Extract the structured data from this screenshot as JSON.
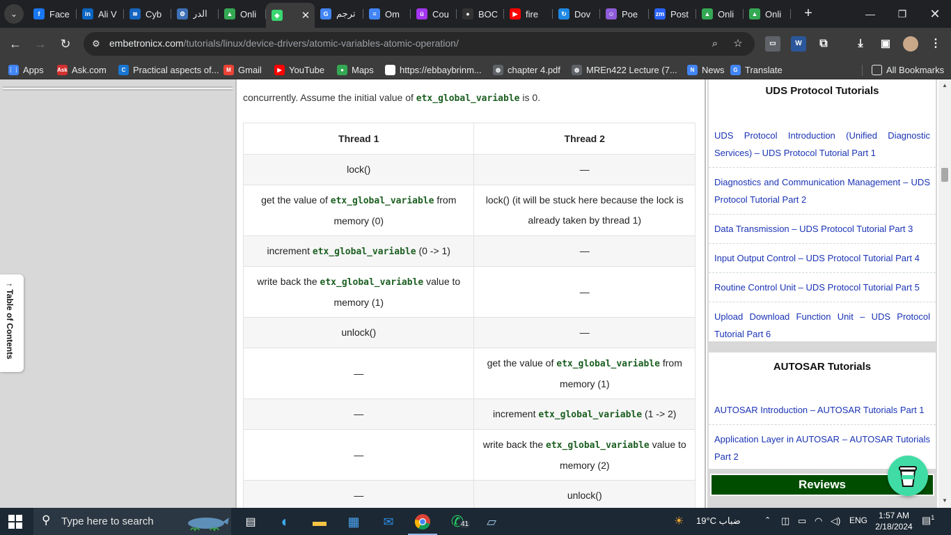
{
  "tabs": [
    {
      "title": "Face",
      "icon": "facebook-icon",
      "color": "#1877f2",
      "glyph": "f"
    },
    {
      "title": "Ali V",
      "icon": "linkedin-icon",
      "color": "#0a66c2",
      "glyph": "in"
    },
    {
      "title": "Cyb",
      "icon": "cyber-icon",
      "color": "#1565c0",
      "glyph": "≋"
    },
    {
      "title": "الدر",
      "icon": "gear-icon",
      "color": "#3d6fb6",
      "glyph": "⚙"
    },
    {
      "title": "Onli",
      "icon": "google-drive-icon",
      "color": "#34a853",
      "glyph": "▲"
    },
    {
      "title": "",
      "icon": "diamond-icon",
      "color": "#3bd671",
      "glyph": "◆",
      "active": true
    },
    {
      "title": "ترجم",
      "icon": "google-translate-icon",
      "color": "#4285f4",
      "glyph": "G"
    },
    {
      "title": "Om",
      "icon": "google-docs-icon",
      "color": "#4285f4",
      "glyph": "≡"
    },
    {
      "title": "Cou",
      "icon": "udemy-icon",
      "color": "#a435f0",
      "glyph": "ü"
    },
    {
      "title": "BOC",
      "icon": "github-icon",
      "color": "#333333",
      "glyph": "●"
    },
    {
      "title": "fire",
      "icon": "youtube-icon",
      "color": "#ff0000",
      "glyph": "▶"
    },
    {
      "title": "Dov",
      "icon": "download-site-icon",
      "color": "#1e88e5",
      "glyph": "↻"
    },
    {
      "title": "Poe",
      "icon": "poe-icon",
      "color": "#8e5cd9",
      "glyph": "☺"
    },
    {
      "title": "Post",
      "icon": "zm-icon",
      "color": "#2962ff",
      "glyph": "zm"
    },
    {
      "title": "Onli",
      "icon": "google-drive-icon",
      "color": "#34a853",
      "glyph": "▲"
    },
    {
      "title": "Onli",
      "icon": "google-drive-icon",
      "color": "#34a853",
      "glyph": "▲"
    }
  ],
  "url": {
    "host": "embetronicx.com",
    "path": "/tutorials/linux/device-drivers/atomic-variables-atomic-operation/"
  },
  "bookmarks": [
    {
      "label": "Apps",
      "icon": "apps-grid-icon",
      "color": "#4285f4",
      "glyph": "⋮⋮"
    },
    {
      "label": "Ask.com",
      "icon": "ask-icon",
      "color": "#d32f2f",
      "glyph": "Ask"
    },
    {
      "label": "Practical aspects of...",
      "icon": "c-icon",
      "color": "#1976d2",
      "glyph": "C"
    },
    {
      "label": "Gmail",
      "icon": "gmail-icon",
      "color": "#ea4335",
      "glyph": "M"
    },
    {
      "label": "YouTube",
      "icon": "youtube-icon",
      "color": "#ff0000",
      "glyph": "▶"
    },
    {
      "label": "Maps",
      "icon": "maps-pin-icon",
      "color": "#34a853",
      "glyph": "●"
    },
    {
      "label": "https://ebbaybrinm...",
      "icon": "blank-page-icon",
      "color": "#ffffff",
      "glyph": ""
    },
    {
      "label": "chapter 4.pdf",
      "icon": "globe-icon",
      "color": "#5f6368",
      "glyph": "◍"
    },
    {
      "label": "MREn422 Lecture (7...",
      "icon": "globe-icon",
      "color": "#5f6368",
      "glyph": "◍"
    },
    {
      "label": "News",
      "icon": "news-icon",
      "color": "#4285f4",
      "glyph": "N"
    },
    {
      "label": "Translate",
      "icon": "google-translate-icon",
      "color": "#4285f4",
      "glyph": "G"
    }
  ],
  "all_bookmarks": "All Bookmarks",
  "toc_label": "↑ Table of Contents",
  "intro": {
    "before": "concurrently. Assume the initial value of ",
    "code": "etx_global_variable",
    "after": " is 0."
  },
  "table": {
    "headers": [
      "Thread 1",
      "Thread 2"
    ],
    "rows": [
      [
        {
          "text": "lock()"
        },
        {
          "text": "—"
        }
      ],
      [
        {
          "pre": "get the value of ",
          "code": "etx_global_variable",
          "post": " from memory (0)"
        },
        {
          "text": "lock() (it will be stuck here because the lock is already taken by thread 1)"
        }
      ],
      [
        {
          "pre": "increment ",
          "code": "etx_global_variable",
          "post": " (0 -> 1)"
        },
        {
          "text": "—"
        }
      ],
      [
        {
          "pre": "write back the ",
          "code": "etx_global_variable",
          "post": " value to memory (1)"
        },
        {
          "text": "—"
        }
      ],
      [
        {
          "text": "unlock()"
        },
        {
          "text": "—"
        }
      ],
      [
        {
          "text": "—"
        },
        {
          "pre": "get the value of ",
          "code": "etx_global_variable",
          "post": " from memory (1)"
        }
      ],
      [
        {
          "text": "—"
        },
        {
          "pre": "increment ",
          "code": "etx_global_variable",
          "post": " (1 -> 2)"
        }
      ],
      [
        {
          "text": "—"
        },
        {
          "pre": "write back the ",
          "code": "etx_global_variable",
          "post": " value to memory (2)"
        }
      ],
      [
        {
          "text": "—"
        },
        {
          "text": "unlock()"
        }
      ]
    ]
  },
  "sidebar": {
    "uds_title": "UDS Protocol Tutorials",
    "uds_links": [
      "UDS Protocol Introduction (Unified Diagnostic Services) – UDS Protocol Tutorial Part 1",
      "Diagnostics and Communication Management – UDS Protocol Tutorial Part 2",
      "Data Transmission – UDS Protocol Tutorial Part 3",
      "Input Output Control – UDS Protocol Tutorial Part 4",
      "Routine Control Unit – UDS Protocol Tutorial Part 5",
      "Upload Download Function Unit – UDS Protocol Tutorial Part 6"
    ],
    "autosar_title": "AUTOSAR Tutorials",
    "autosar_links": [
      "AUTOSAR Introduction – AUTOSAR Tutorials Part 1",
      "Application Layer in AUTOSAR – AUTOSAR Tutorials Part 2"
    ],
    "reviews": "Reviews"
  },
  "taskbar": {
    "search_placeholder": "Type here to search",
    "whatsapp_badge": "41",
    "weather": "19°C  ضباب",
    "lang": "ENG",
    "time": "1:57 AM",
    "date": "2/18/2024",
    "notifications": "1"
  },
  "colors": {
    "accent_green": "#004d00",
    "code_green": "#1b5e20",
    "link_blue": "#1a33b5"
  }
}
